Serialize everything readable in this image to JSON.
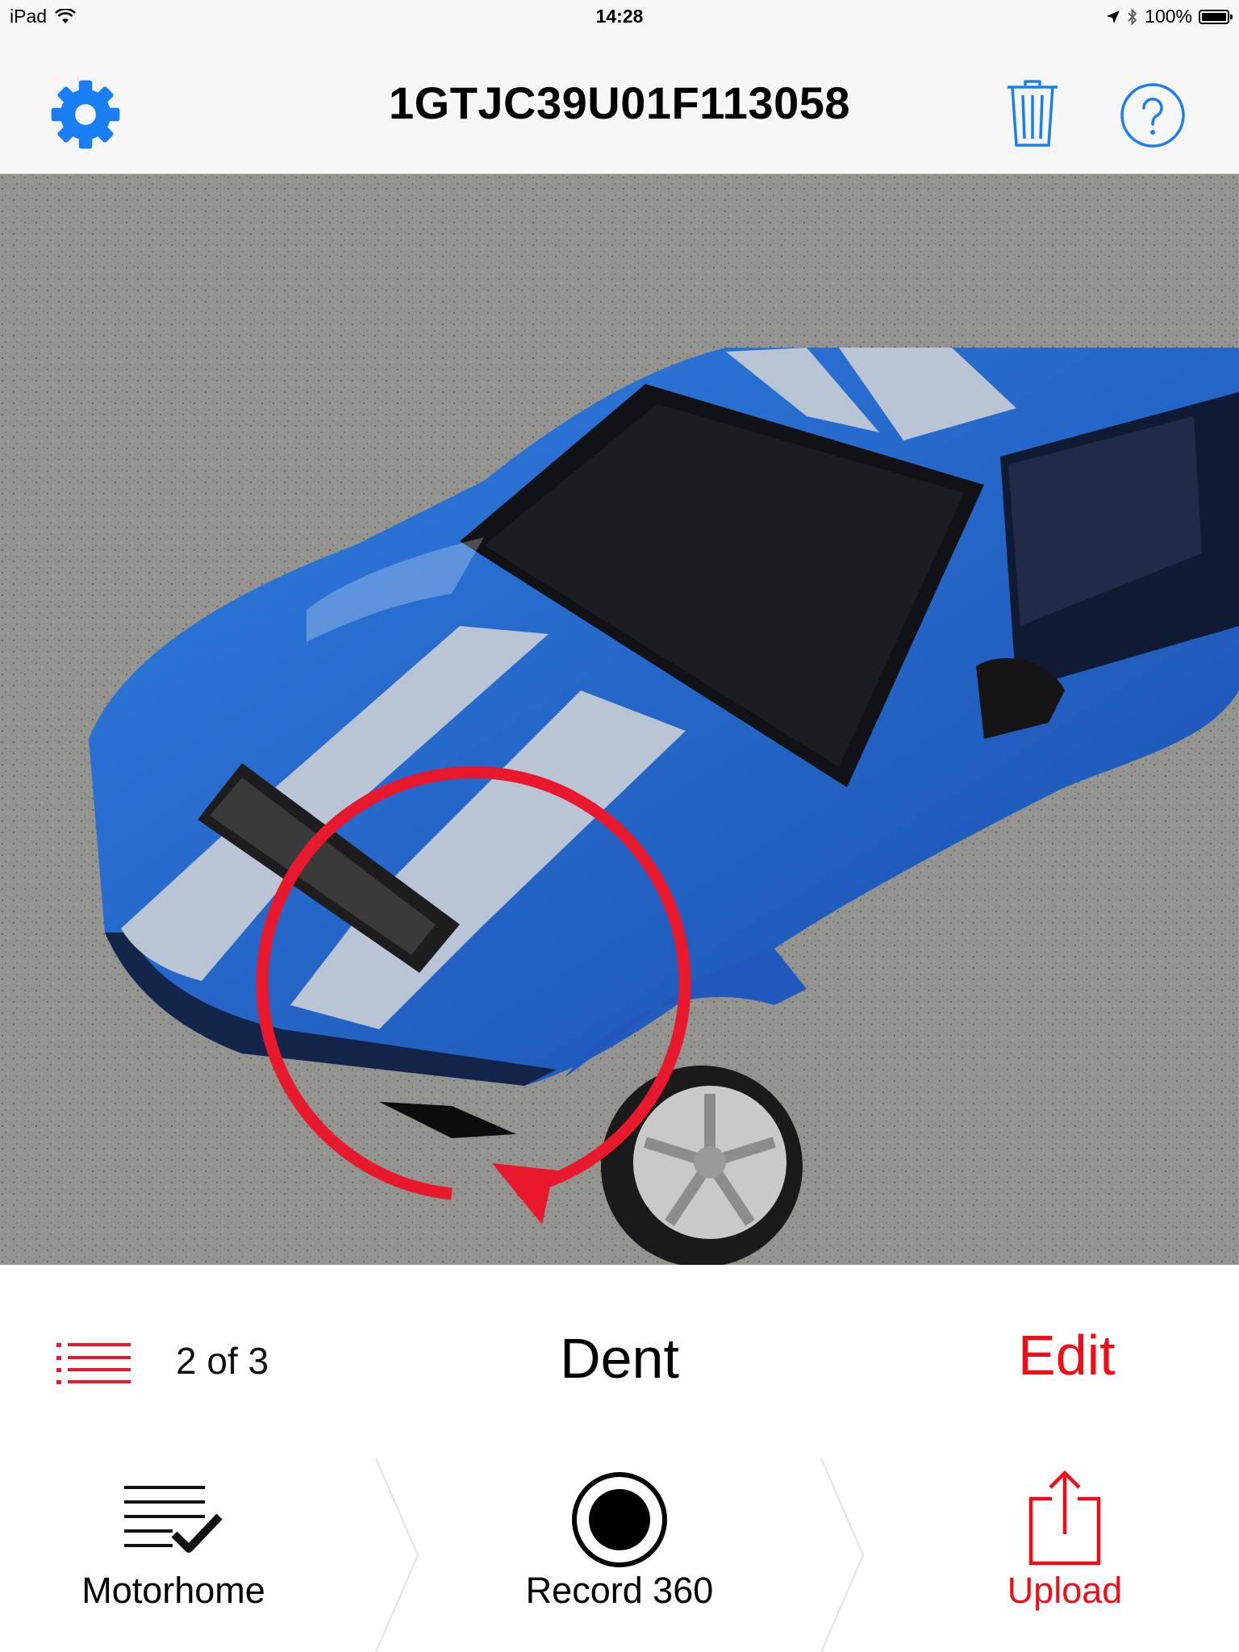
{
  "status_bar": {
    "device": "iPad",
    "time": "14:28",
    "battery": "100%"
  },
  "nav": {
    "title": "1GTJC39U01F113058",
    "accent_color": "#1a7ef5"
  },
  "info_row": {
    "counter": "2 of 3",
    "damage_type": "Dent",
    "edit_label": "Edit",
    "accent_color": "#f00d17"
  },
  "toolbar": {
    "items": [
      {
        "label": "Motorhome",
        "icon": "checklist-icon",
        "color": "#000000"
      },
      {
        "label": "Record 360",
        "icon": "record-icon",
        "color": "#000000"
      },
      {
        "label": "Upload",
        "icon": "upload-icon",
        "color": "#f00d17"
      }
    ]
  },
  "icons": {
    "settings": "gear-icon",
    "delete": "trash-icon",
    "help": "help-icon",
    "list": "list-icon",
    "annotation": "circular-arrow-annotation"
  }
}
